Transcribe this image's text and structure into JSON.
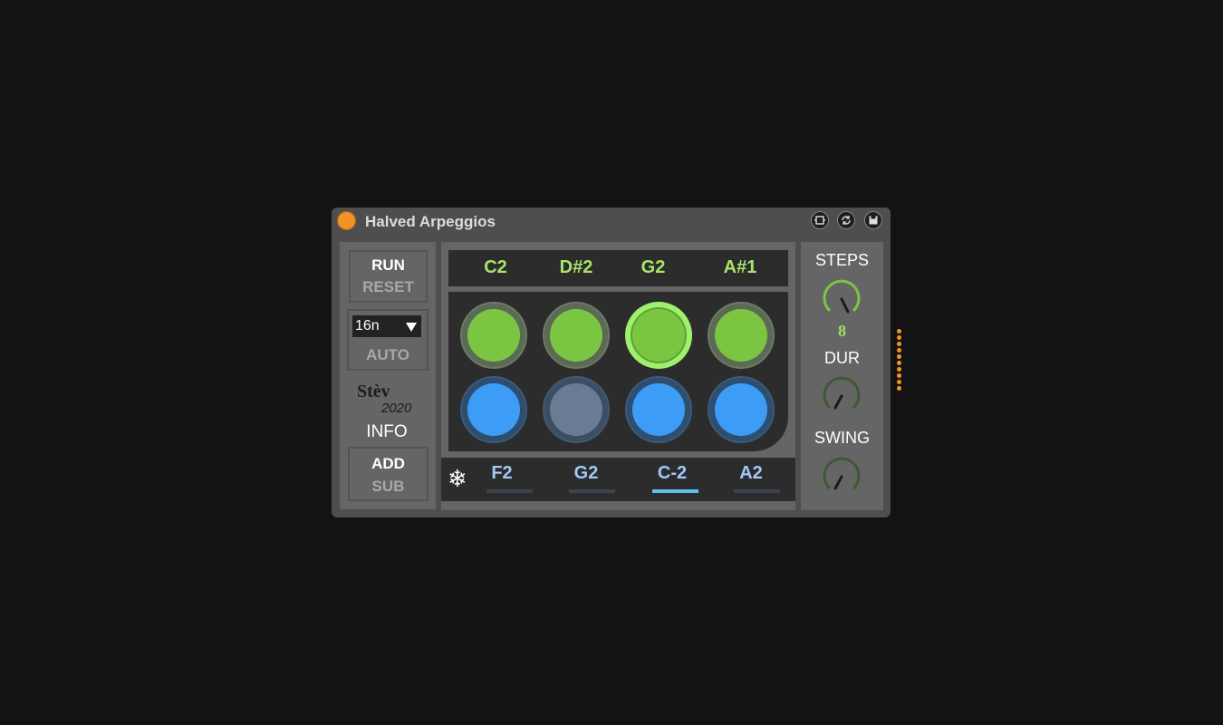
{
  "title": "Halved Arpeggios",
  "colors": {
    "power": "#f39325",
    "green_note": "#a8e46c",
    "blue_note": "#a0c8f8",
    "pad_green": "#7cc543",
    "pad_blue": "#3d9cf6",
    "panel": "#656565",
    "device": "#4e4e4e"
  },
  "titlebar_icons": [
    "pin-icon",
    "refresh-icon",
    "save-icon"
  ],
  "left": {
    "run": "RUN",
    "reset": "RESET",
    "rate": "16n",
    "auto": "AUTO",
    "author": "Stèv",
    "year": "2020",
    "info": "INFO",
    "add": "ADD",
    "sub": "SUB"
  },
  "top_notes": [
    "C2",
    "D#2",
    "G2",
    "A#1"
  ],
  "bottom_notes": [
    "F2",
    "G2",
    "C-2",
    "A2"
  ],
  "pads_top": [
    "on",
    "on",
    "active",
    "on"
  ],
  "pads_bottom": [
    "on",
    "off",
    "on",
    "on"
  ],
  "active_bottom_index": 2,
  "right": {
    "steps_label": "STEPS",
    "steps_value": "8",
    "dur_label": "DUR",
    "swing_label": "SWING"
  }
}
